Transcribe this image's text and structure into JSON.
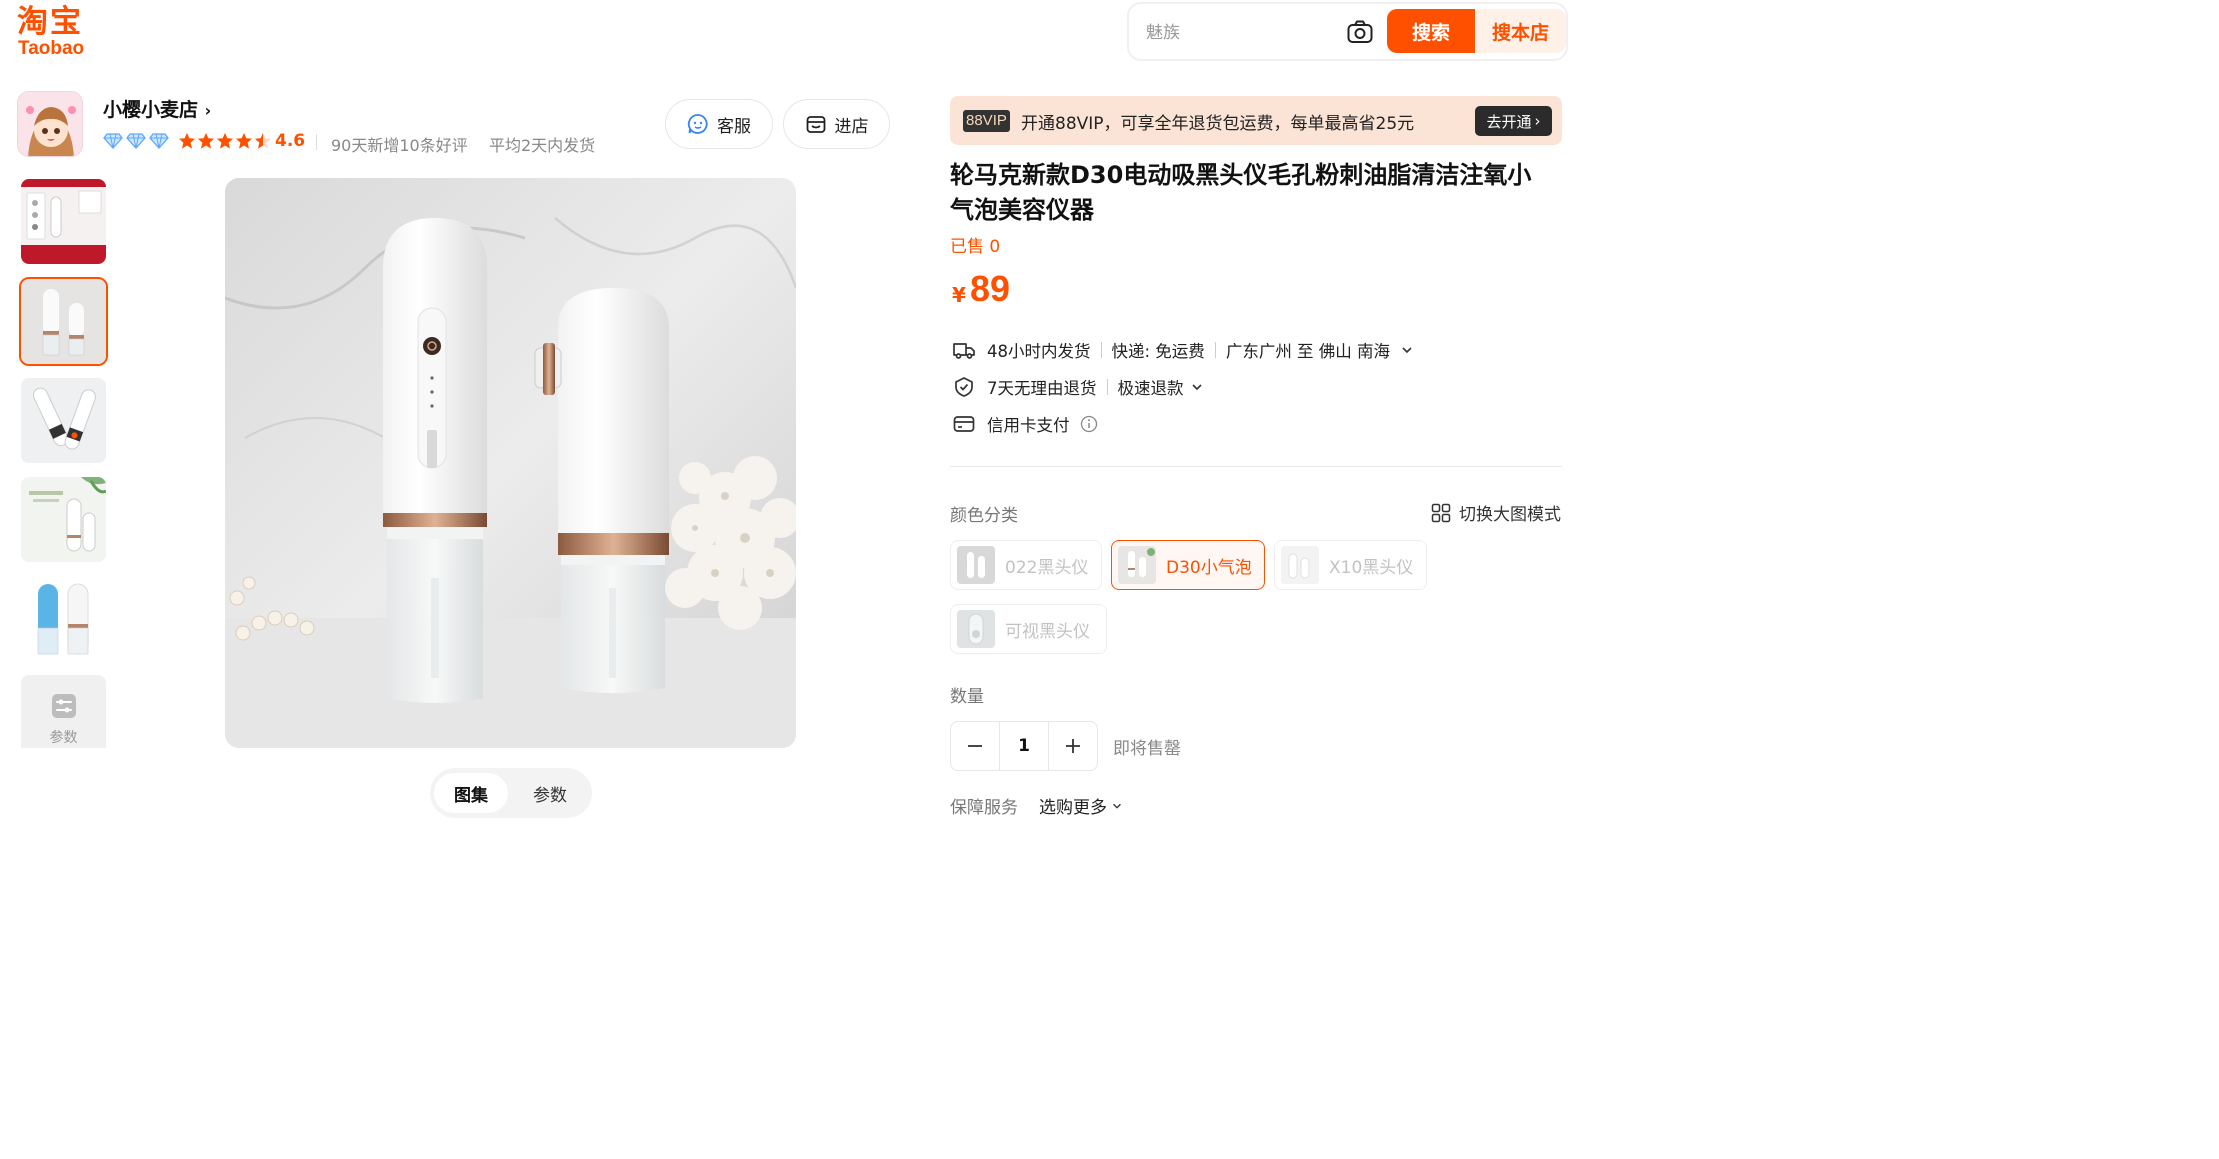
{
  "logo": {
    "cn": "淘宝",
    "en": "Taobao"
  },
  "search": {
    "placeholder": "魅族",
    "submit": "搜索",
    "shop_submit": "搜本店"
  },
  "shop": {
    "name": "小樱小麦店",
    "rating": "4.6",
    "stat_reviews": "90天新增10条好评",
    "stat_shipping": "平均2天内发货",
    "customer_service": "客服",
    "enter_shop": "进店",
    "diamond_level": 3,
    "stars": 4.5
  },
  "gallery": {
    "params_label": "参数",
    "tabs": [
      "图集",
      "参数"
    ]
  },
  "vip": {
    "badge": "88VIP",
    "text": "开通88VIP，可享全年退货包运费，每单最高省25元",
    "open_label": "去开通"
  },
  "product": {
    "title": "轮马克新款D30电动吸黑头仪毛孔粉刺油脂清洁注氧小气泡美容仪器",
    "sold": "已售 0",
    "currency": "¥",
    "price": "89"
  },
  "delivery": {
    "time": "48小时内发货",
    "express": "快递: 免运费",
    "route": "广东广州 至 佛山 南海"
  },
  "returns": {
    "policy": "7天无理由退货",
    "refund": "极速退款"
  },
  "payment": {
    "method": "信用卡支付"
  },
  "sku": {
    "label": "颜色分类",
    "switch_mode": "切换大图模式",
    "options": [
      "022黑头仪",
      "D30小气泡",
      "X10黑头仪",
      "可视黑头仪"
    ],
    "selected": "D30小气泡"
  },
  "quantity": {
    "label": "数量",
    "value": "1",
    "note": "即将售罄"
  },
  "guarantee": {
    "label": "保障服务",
    "more": "选购更多"
  },
  "colors": {
    "accent": "#ff5000",
    "vip_bg": "#fbe4d6"
  }
}
